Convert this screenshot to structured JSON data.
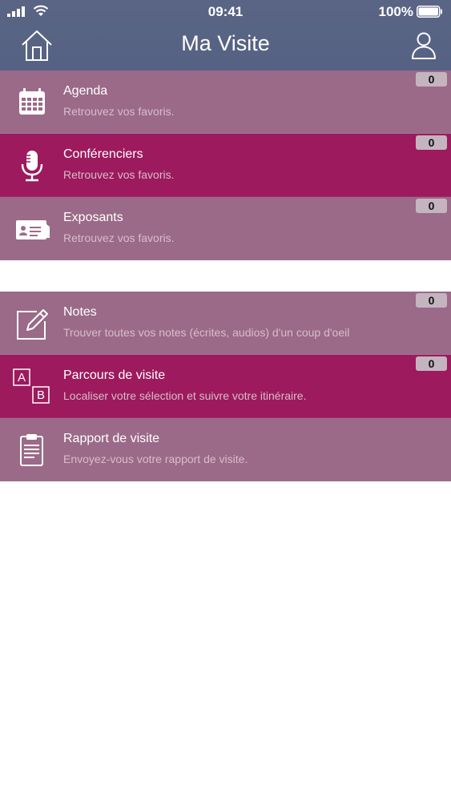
{
  "status_bar": {
    "time": "09:41",
    "battery": "100%",
    "icons": [
      "signal-icon",
      "wifi-icon",
      "battery-icon"
    ]
  },
  "header": {
    "title": "Ma Visite",
    "left_icon": "home-icon",
    "right_icon": "user-icon",
    "background_color": "#5a6585"
  },
  "colors": {
    "row_muted": "#9b6a88",
    "row_bright": "#9c1a5d",
    "badge": "#c3b4bf"
  },
  "sections": [
    {
      "items": [
        {
          "title": "Agenda",
          "subtitle": "Retrouvez vos favoris.",
          "count": "0",
          "icon": "calendar-icon",
          "style": "muted"
        },
        {
          "title": "Conférenciers",
          "subtitle": "Retrouvez vos favoris.",
          "count": "0",
          "icon": "microphone-icon",
          "style": "bright"
        },
        {
          "title": "Exposants",
          "subtitle": "Retrouvez vos favoris.",
          "count": "0",
          "icon": "business-card-icon",
          "style": "muted"
        }
      ]
    },
    {
      "items": [
        {
          "title": "Notes",
          "subtitle": "Trouver toutes vos notes (écrites, audios) d'un coup d'oeil",
          "count": "0",
          "icon": "note-edit-icon",
          "style": "muted"
        },
        {
          "title": "Parcours de visite",
          "subtitle": "Localiser votre sélection et suivre votre itinéraire.",
          "count": "0",
          "icon": "route-ab-icon",
          "style": "bright"
        },
        {
          "title": "Rapport de visite",
          "subtitle": "Envoyez-vous votre rapport de visite.",
          "icon": "clipboard-icon",
          "style": "muted"
        }
      ]
    }
  ]
}
